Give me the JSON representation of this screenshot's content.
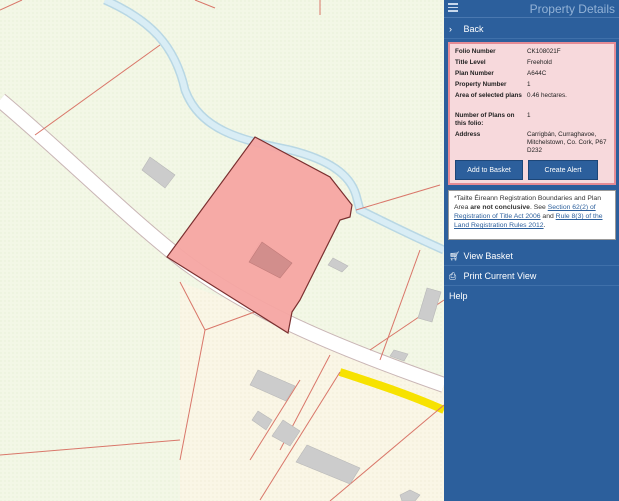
{
  "panel": {
    "title": "Property Details",
    "back_label": "Back",
    "details": {
      "folio_label": "Folio Number",
      "folio_value": "CK108021F",
      "title_level_label": "Title Level",
      "title_level_value": "Freehold",
      "plan_label": "Plan Number",
      "plan_value": "A644C",
      "property_label": "Property Number",
      "property_value": "1",
      "area_label": "Area of selected plans",
      "area_value": "0.46 hectares.",
      "num_plans_label": "Number of Plans on this folio:",
      "num_plans_value": "1",
      "address_label": "Address",
      "address_value": "Carrigbán, Curraghavoe, Mitchelstown, Co. Cork, P67 D232"
    },
    "add_to_basket_label": "Add to Basket",
    "create_alert_label": "Create Alert",
    "notice": {
      "part1": "*Tailte Éireann Registration Boundaries and Plan Area ",
      "bold": "are not conclusive",
      "part2": ". See ",
      "link1": "Section 62(2) of Registration of Title Act 2006",
      "part3": " and ",
      "link2": "Rule 8(3) of the Land Registration Rules 2012",
      "part4": "."
    },
    "view_basket_label": "View Basket",
    "print_label": "Print Current View",
    "help_label": "Help"
  },
  "colors": {
    "panel_bg": "#2c5f9c",
    "details_bg": "#f7d9dc",
    "details_border": "#e58b95",
    "selected_parcel": "#f5a5a2",
    "river": "#cfe8f2"
  },
  "icons": {
    "menu": "hamburger-icon",
    "back": "chevron-right-icon",
    "basket": "cart-icon",
    "print": "printer-icon"
  }
}
